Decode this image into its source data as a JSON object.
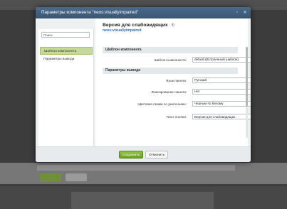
{
  "dialog": {
    "title": "Параметры компонента \"neos:visuallyimpaired\"",
    "controls": [
      "▫",
      "✕"
    ]
  },
  "sidebar": {
    "search_value": "Поиск",
    "items": [
      {
        "label": "Шаблон компонента",
        "active": true
      },
      {
        "label": "Параметры вывода",
        "active": false
      }
    ]
  },
  "content": {
    "title": "Версия для слабовидящих",
    "info_icon": "i",
    "component_code": "neos:visuallyimpaired",
    "sections": [
      {
        "title": "Шаблон компонента",
        "fields": [
          {
            "label": "Шаблон компонента:",
            "type": "select",
            "value": "default (Встроенный шаблон)"
          }
        ]
      },
      {
        "title": "Параметры вывода",
        "fields": [
          {
            "label": "Язык панели:",
            "type": "select",
            "value": "Русский"
          },
          {
            "label": "Фиксирование панели:",
            "type": "select",
            "value": "Нет"
          },
          {
            "label": "Цветовая гамма по умолчанию:",
            "type": "select",
            "value": "Черным по белому"
          },
          {
            "label": "Текст кнопки:",
            "type": "input",
            "value": "Версия для слабовидящих"
          }
        ]
      }
    ]
  },
  "footer": {
    "save_label": "Сохранить",
    "cancel_label": "Отменить"
  },
  "colors": {
    "titlebar": "#3f5d7c",
    "accent_green": "#7bb02f",
    "active_item": "#c6d99a",
    "link_blue": "#2e6fad"
  }
}
